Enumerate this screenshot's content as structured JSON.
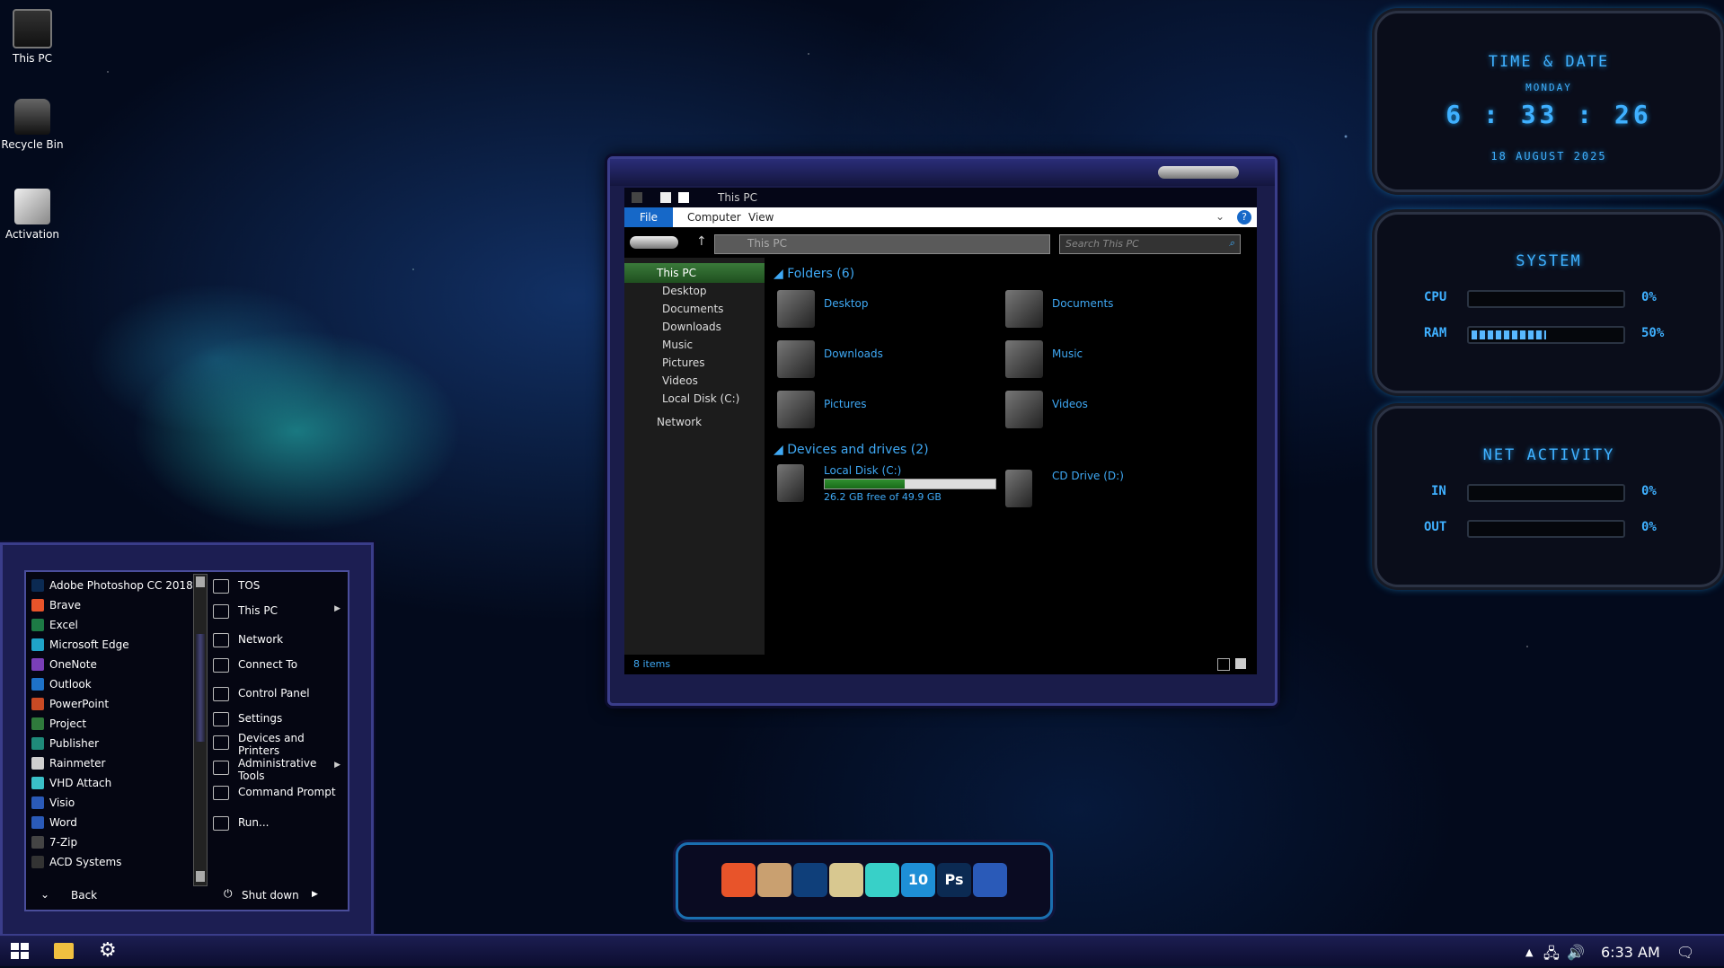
{
  "desktop": {
    "icons": [
      {
        "label": "This PC",
        "icon": "computer-icon"
      },
      {
        "label": "Recycle Bin",
        "icon": "recycle-bin-icon"
      },
      {
        "label": "Activation",
        "icon": "activation-icon"
      }
    ]
  },
  "explorer": {
    "title": "This PC",
    "ribbon": {
      "file": "File",
      "computer": "Computer",
      "view": "View"
    },
    "address": "This PC",
    "search_placeholder": "Search This PC",
    "nav": [
      {
        "label": "This PC"
      },
      {
        "label": "Desktop"
      },
      {
        "label": "Documents"
      },
      {
        "label": "Downloads"
      },
      {
        "label": "Music"
      },
      {
        "label": "Pictures"
      },
      {
        "label": "Videos"
      },
      {
        "label": "Local Disk (C:)"
      },
      {
        "label": "Network"
      }
    ],
    "folders_header": "Folders (6)",
    "folders": [
      {
        "label": "Desktop"
      },
      {
        "label": "Documents"
      },
      {
        "label": "Downloads"
      },
      {
        "label": "Music"
      },
      {
        "label": "Pictures"
      },
      {
        "label": "Videos"
      }
    ],
    "drives_header": "Devices and drives (2)",
    "drives": [
      {
        "label": "Local Disk (C:)",
        "free": "26.2 GB free of 49.9 GB",
        "used_fraction": 0.47
      },
      {
        "label": "CD Drive (D:)"
      }
    ],
    "status": "8 items"
  },
  "start_menu": {
    "apps": [
      {
        "label": "Adobe Photoshop CC 2018",
        "color": "#0b2a52"
      },
      {
        "label": "Brave",
        "color": "#e8542a"
      },
      {
        "label": "Excel",
        "color": "#1d7a45"
      },
      {
        "label": "Microsoft Edge",
        "color": "#1fa3c8"
      },
      {
        "label": "OneNote",
        "color": "#7a3fb8"
      },
      {
        "label": "Outlook",
        "color": "#1e72c8"
      },
      {
        "label": "PowerPoint",
        "color": "#c94a24"
      },
      {
        "label": "Project",
        "color": "#2f7a3c"
      },
      {
        "label": "Publisher",
        "color": "#1f8a7a"
      },
      {
        "label": "Rainmeter",
        "color": "#cfcfcf"
      },
      {
        "label": "VHD Attach",
        "color": "#3ac0c8"
      },
      {
        "label": "Visio",
        "color": "#2a5ab8"
      },
      {
        "label": "Word",
        "color": "#2a5ab8"
      },
      {
        "label": "7-Zip",
        "color": "#444444"
      },
      {
        "label": "ACD Systems",
        "color": "#333333"
      }
    ],
    "places": [
      {
        "label": "TOS",
        "icon": "document-icon"
      },
      {
        "label": "This PC",
        "icon": "computer-icon",
        "arrow": "▶"
      },
      {
        "label": "Network",
        "icon": "network-icon"
      },
      {
        "label": "Connect To",
        "icon": "connect-icon"
      },
      {
        "label": "Control Panel",
        "icon": "control-panel-icon"
      },
      {
        "label": "Settings",
        "icon": "gear-icon"
      },
      {
        "label": "Devices and Printers",
        "icon": "printer-icon"
      },
      {
        "label": "Administrative Tools",
        "icon": "tools-icon",
        "arrow": "▶"
      },
      {
        "label": "Command Prompt",
        "icon": "terminal-icon"
      },
      {
        "label": "Run...",
        "icon": "run-icon"
      }
    ],
    "back": "Back",
    "shutdown": "Shut down"
  },
  "dock": {
    "items": [
      {
        "icon": "brave-icon",
        "color": "#e8542a"
      },
      {
        "icon": "disc-icon",
        "color": "#c9a070"
      },
      {
        "icon": "dots-icon",
        "color": "#0f3f7a"
      },
      {
        "icon": "drive-icon",
        "color": "#d8c890"
      },
      {
        "icon": "usb-drive-icon",
        "color": "#38d0c8"
      },
      {
        "icon": "windows10-icon",
        "color": "#1e8fd6",
        "text": "10"
      },
      {
        "icon": "photoshop-icon",
        "color": "#0b2a52",
        "text": "Ps"
      },
      {
        "icon": "camera-icon",
        "color": "#2a5ab8"
      }
    ]
  },
  "widgets": {
    "time": {
      "title": "TIME & DATE",
      "day": "MONDAY",
      "hours": "6",
      "minutes": "33",
      "seconds": "26",
      "date": "18 AUGUST 2025"
    },
    "system": {
      "title": "SYSTEM",
      "cpu_label": "CPU",
      "cpu_value": "0%",
      "cpu_fraction": 0.0,
      "ram_label": "RAM",
      "ram_value": "50%",
      "ram_fraction": 0.5
    },
    "net": {
      "title": "NET ACTIVITY",
      "in_label": "IN",
      "in_value": "0%",
      "in_fraction": 0.0,
      "out_label": "OUT",
      "out_value": "0%",
      "out_fraction": 0.0
    }
  },
  "taskbar": {
    "clock": "6:33 AM"
  },
  "colors": {
    "accent": "#3fa9f5",
    "widget_glow": "#1e8fd6"
  }
}
